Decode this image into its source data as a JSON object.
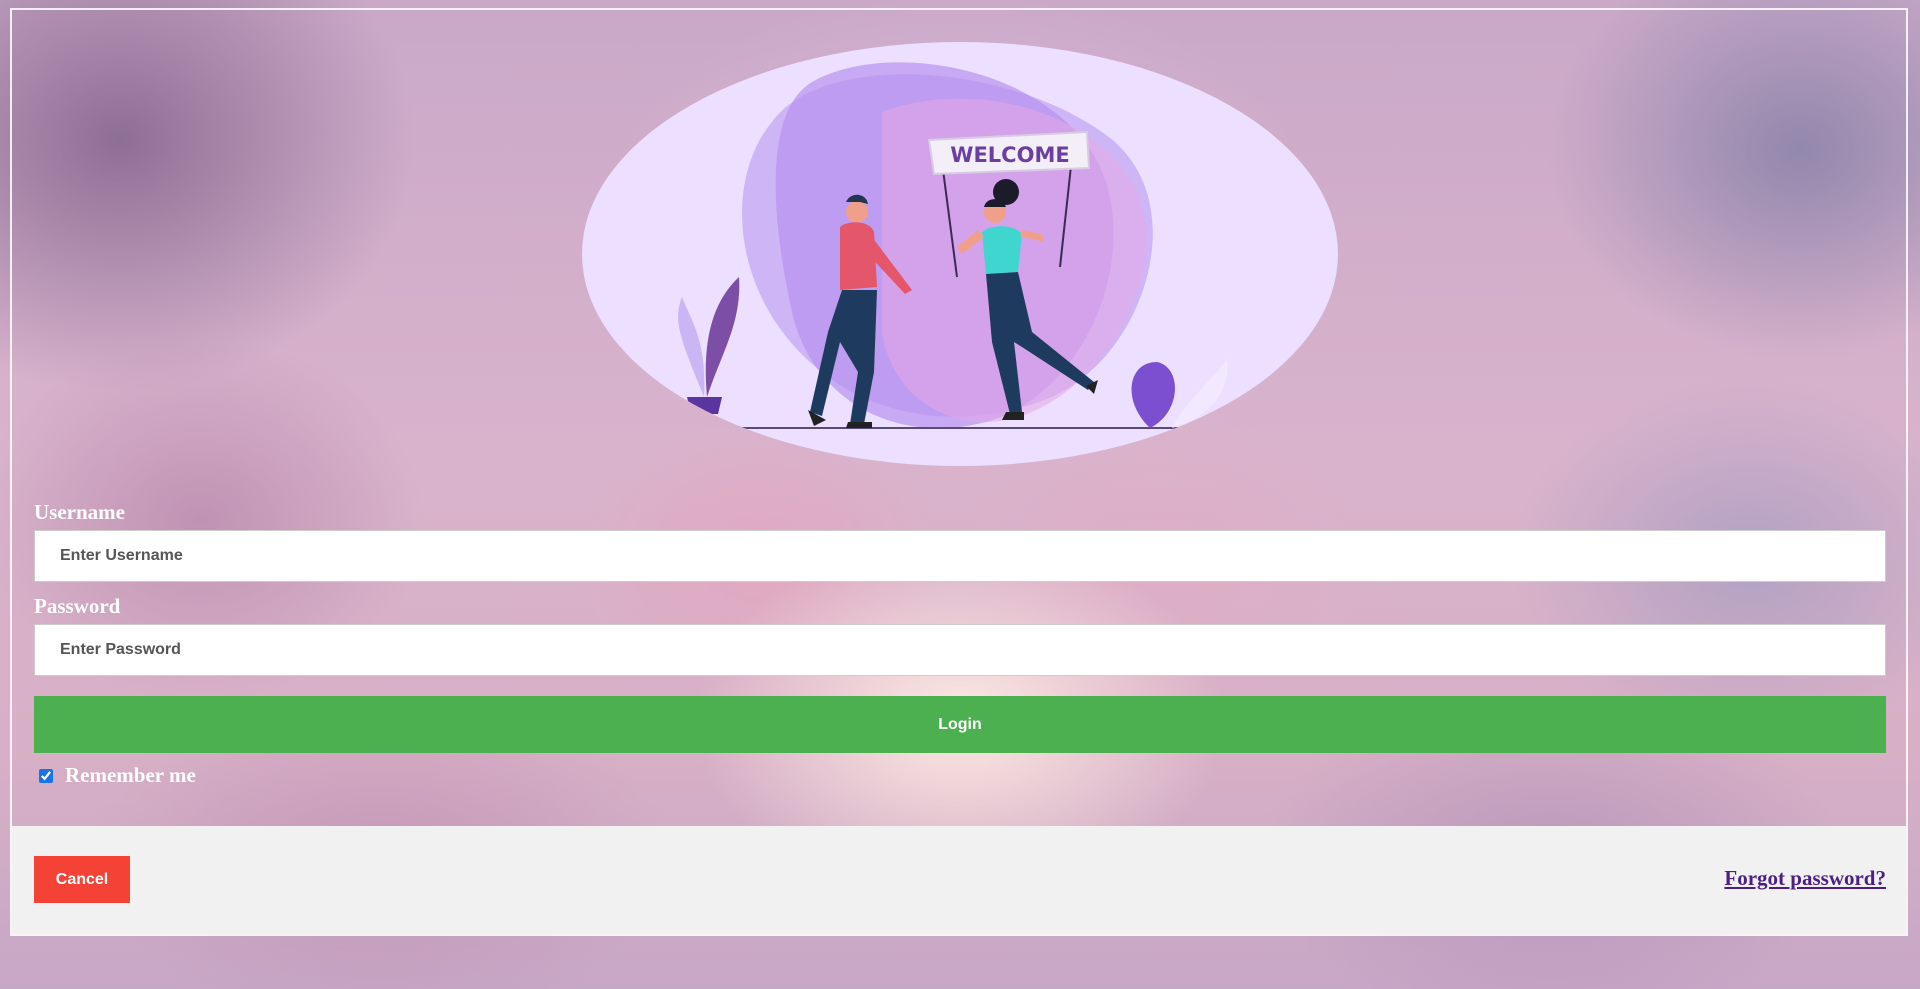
{
  "hero": {
    "banner_text": "WELCOME",
    "illustration_icon": "welcome-illustration"
  },
  "form": {
    "username_label": "Username",
    "username_placeholder": "Enter Username",
    "username_value": "",
    "password_label": "Password",
    "password_placeholder": "Enter Password",
    "password_value": "",
    "login_label": "Login",
    "remember_label": "Remember me",
    "remember_checked": true
  },
  "footer": {
    "cancel_label": "Cancel",
    "forgot_label": "Forgot password?"
  },
  "colors": {
    "login_button": "#4caf50",
    "cancel_button": "#f44336",
    "forgot_link": "#4b1f86",
    "footer_background": "#f1f1f1",
    "hero_background": "#ecdfff"
  }
}
